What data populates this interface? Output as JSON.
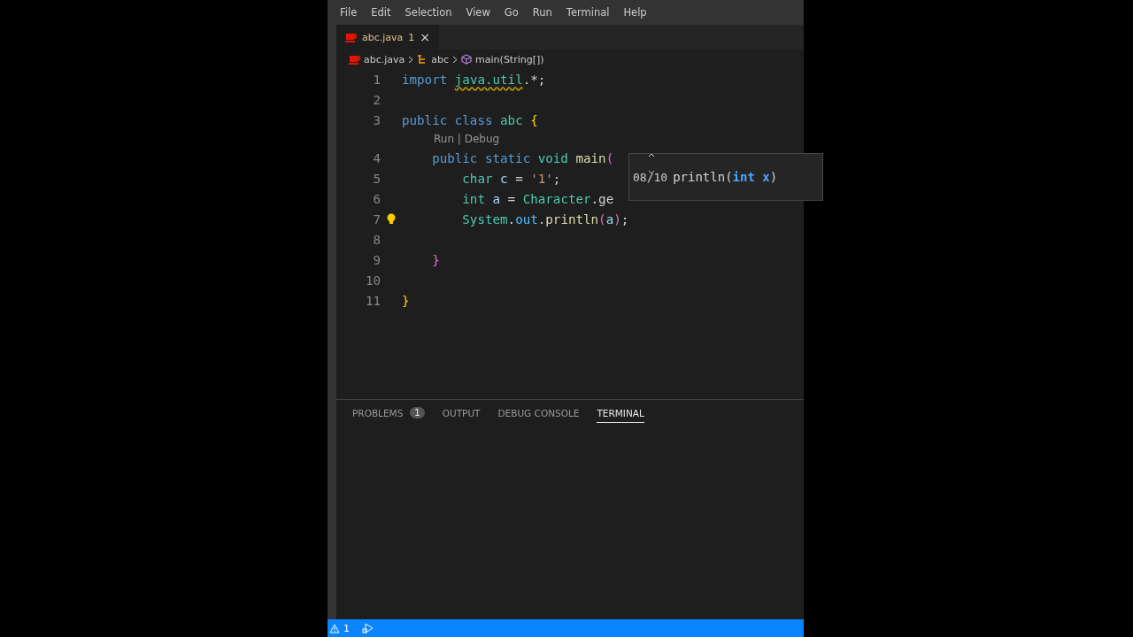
{
  "menu": [
    "File",
    "Edit",
    "Selection",
    "View",
    "Go",
    "Run",
    "Terminal",
    "Help"
  ],
  "tabs": [
    {
      "label": "abc.java",
      "badge": "1",
      "close": "×",
      "selected": true
    }
  ],
  "breadcrumb": [
    {
      "label": "abc.java",
      "kind": "file"
    },
    {
      "label": "abc",
      "kind": "class"
    },
    {
      "label": "main(String[])",
      "kind": "method"
    }
  ],
  "editor": {
    "lines": [
      {
        "number": "1",
        "tokens": [
          {
            "text": "import ",
            "kind": "keyword"
          },
          {
            "text": "java.util",
            "kind": "type",
            "squiggle": true
          },
          {
            "text": ".*;",
            "kind": "plain"
          }
        ]
      },
      {
        "number": "2"
      },
      {
        "number": "3",
        "tokens": [
          {
            "text": "public class ",
            "kind": "keyword"
          },
          {
            "text": "abc ",
            "kind": "type"
          },
          {
            "text": "{",
            "kind": "brace1"
          }
        ],
        "codelens": "Run | Debug"
      },
      {
        "number": "4",
        "tokens": [
          {
            "text": "    public static ",
            "kind": "keyword"
          },
          {
            "text": "void ",
            "kind": "type"
          },
          {
            "text": "main",
            "kind": "function"
          },
          {
            "text": "(",
            "kind": "brace2"
          }
        ]
      },
      {
        "number": "5",
        "tokens": [
          {
            "text": "        char ",
            "kind": "type"
          },
          {
            "text": "c",
            "kind": "variable"
          },
          {
            "text": " = ",
            "kind": "plain"
          },
          {
            "text": "'1'",
            "kind": "string"
          },
          {
            "text": ";",
            "kind": "plain"
          }
        ]
      },
      {
        "number": "6",
        "tokens": [
          {
            "text": "        int ",
            "kind": "type"
          },
          {
            "text": "a",
            "kind": "variable"
          },
          {
            "text": " = ",
            "kind": "plain"
          },
          {
            "text": "Character",
            "kind": "type"
          },
          {
            "text": ".ge",
            "kind": "plain"
          }
        ]
      },
      {
        "number": "7",
        "tokens": [
          {
            "text": "        System",
            "kind": "type"
          },
          {
            "text": ".",
            "kind": "plain"
          },
          {
            "text": "out",
            "kind": "constant"
          },
          {
            "text": ".",
            "kind": "plain"
          },
          {
            "text": "println",
            "kind": "function"
          },
          {
            "text": "(",
            "kind": "brace2"
          },
          {
            "text": "a",
            "kind": "variable"
          },
          {
            "text": ")",
            "kind": "brace2"
          },
          {
            "text": ";",
            "kind": "plain"
          }
        ],
        "lightbulb": true
      },
      {
        "number": "8"
      },
      {
        "number": "9",
        "tokens": [
          {
            "text": "    }",
            "kind": "brace2"
          }
        ]
      },
      {
        "number": "10"
      },
      {
        "number": "11",
        "tokens": [
          {
            "text": "}",
            "kind": "brace1"
          }
        ]
      }
    ]
  },
  "signature_help": {
    "counter": "08/10",
    "parts": [
      {
        "text": "println(",
        "kind": "plain"
      },
      {
        "text": "int x",
        "kind": "param"
      },
      {
        "text": ")",
        "kind": "plain"
      }
    ]
  },
  "panel_tabs": [
    {
      "label": "PROBLEMS",
      "badge": "1",
      "selected": false
    },
    {
      "label": "OUTPUT",
      "selected": false
    },
    {
      "label": "DEBUG CONSOLE",
      "selected": false
    },
    {
      "label": "TERMINAL",
      "selected": true
    }
  ],
  "status_bar": {
    "warnings": "1"
  }
}
